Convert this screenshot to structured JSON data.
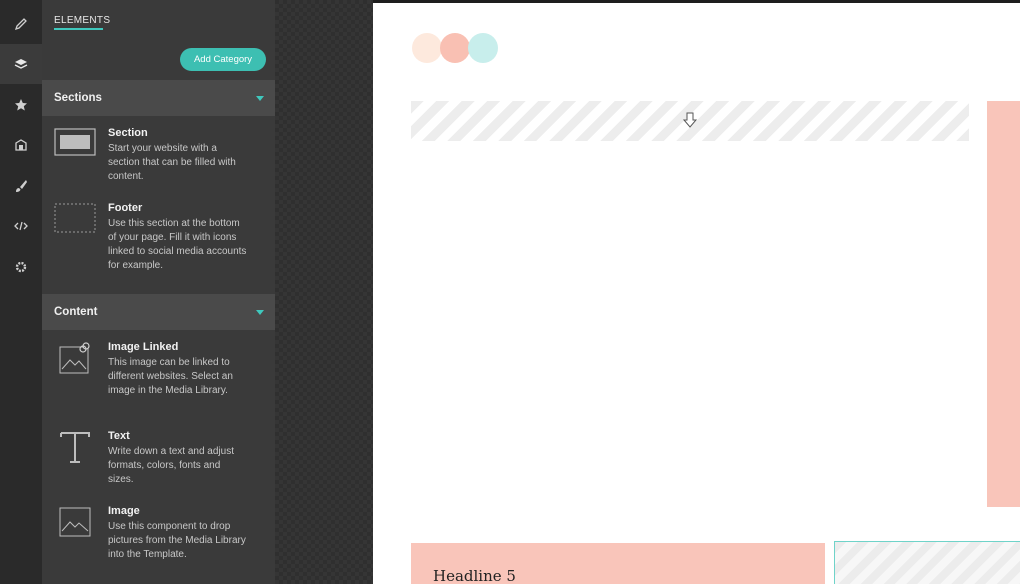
{
  "rail": {
    "items": [
      {
        "icon": "pencil-icon"
      },
      {
        "icon": "layers-icon",
        "active": true
      },
      {
        "icon": "star-icon"
      },
      {
        "icon": "store-icon"
      },
      {
        "icon": "brush-icon"
      },
      {
        "icon": "code-icon"
      },
      {
        "icon": "gear-icon"
      }
    ]
  },
  "panel": {
    "tab_label": "ELEMENTS",
    "add_category_label": "Add Category",
    "sections": [
      {
        "title": "Sections",
        "items": [
          {
            "title": "Section",
            "desc": "Start your website with a section that can be filled with content.",
            "icon": "section-icon"
          },
          {
            "title": "Footer",
            "desc": "Use this section at the bottom of your page. Fill it with icons linked to social media accounts for example.",
            "icon": "footer-icon"
          }
        ]
      },
      {
        "title": "Content",
        "items": [
          {
            "title": "Image Linked",
            "desc": "This image can be linked to different websites. Select an image in the Media Library.",
            "icon": "image-link-icon"
          },
          {
            "title": "Text",
            "desc": "Write down a text and adjust formats, colors, fonts and sizes.",
            "icon": "text-icon"
          },
          {
            "title": "Image",
            "desc": "Use this component to drop pictures from the Media Library into the Template.",
            "icon": "image-icon"
          }
        ]
      }
    ]
  },
  "canvas": {
    "circle_colors": [
      "#fde9dd",
      "#f9c0b3",
      "#c8eeec"
    ],
    "accent": "#3dbfb2",
    "pink": "#f9c5ba",
    "headline": "Headline 5"
  }
}
